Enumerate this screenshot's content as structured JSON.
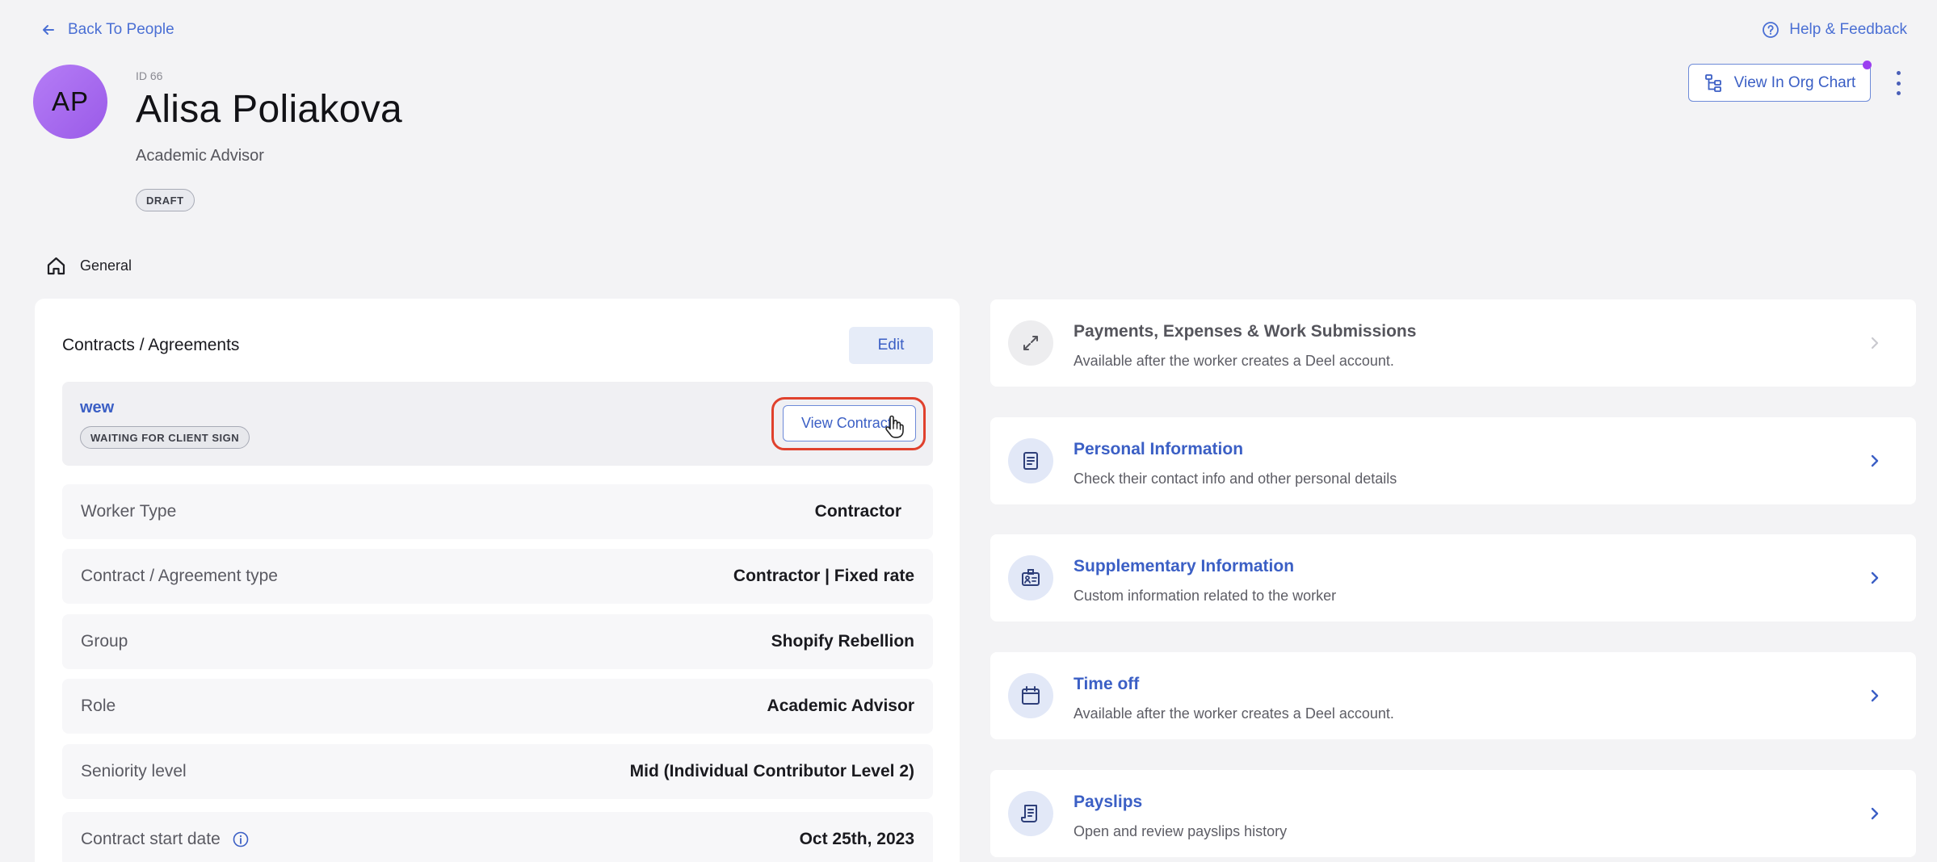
{
  "header": {
    "back_label": "Back To People",
    "help_label": "Help & Feedback",
    "org_chart_label": "View In Org Chart"
  },
  "profile": {
    "initials": "AP",
    "id_label": "ID 66",
    "name": "Alisa Poliakova",
    "role": "Academic Advisor",
    "status": "DRAFT"
  },
  "section_nav": {
    "label": "General"
  },
  "contracts": {
    "title": "Contracts / Agreements",
    "edit_label": "Edit",
    "contract_name": "wew",
    "contract_status": "WAITING FOR CLIENT SIGN",
    "view_contract_label": "View Contract",
    "fields": [
      {
        "label": "Worker Type",
        "value": "Contractor"
      },
      {
        "label": "Contract / Agreement type",
        "value": "Contractor | Fixed rate"
      },
      {
        "label": "Group",
        "value": "Shopify Rebellion"
      },
      {
        "label": "Role",
        "value": "Academic Advisor"
      },
      {
        "label": "Seniority level",
        "value": "Mid (Individual Contributor Level 2)"
      },
      {
        "label": "Contract start date",
        "value": "Oct 25th, 2023"
      }
    ]
  },
  "right_cards": [
    {
      "title": "Payments, Expenses & Work Submissions",
      "subtitle": "Available after the worker creates a Deel account.",
      "icon": "arrows-icon",
      "disabled": true
    },
    {
      "title": "Personal Information",
      "subtitle": "Check their contact info and other personal details",
      "icon": "document-icon",
      "disabled": false
    },
    {
      "title": "Supplementary Information",
      "subtitle": "Custom information related to the worker",
      "icon": "id-badge-icon",
      "disabled": false
    },
    {
      "title": "Time off",
      "subtitle": "Available after the worker creates a Deel account.",
      "icon": "calendar-icon",
      "disabled": false
    },
    {
      "title": "Payslips",
      "subtitle": "Open and review payslips history",
      "icon": "receipt-icon",
      "disabled": false
    }
  ],
  "colors": {
    "accent": "#3b5fc5",
    "highlight": "#e0412d",
    "avatar": "#a96df2",
    "notification": "#9b3ff0"
  }
}
